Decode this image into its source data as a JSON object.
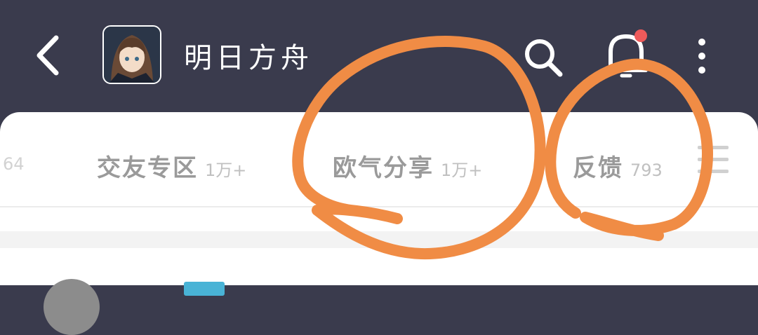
{
  "header": {
    "title": "明日方舟",
    "icons": [
      "back-arrow-icon",
      "app-avatar",
      "search-icon",
      "bell-icon",
      "more-vertical-icon"
    ],
    "has_notification": true
  },
  "tabs": {
    "leading_partial_count": "64",
    "items": [
      {
        "label": "交友专区",
        "count": "1万+"
      },
      {
        "label": "欧气分享",
        "count": "1万+"
      },
      {
        "label": "反馈",
        "count": "793"
      }
    ]
  },
  "colors": {
    "header_bg": "#3a3b4d",
    "card_bg": "#ffffff",
    "tab_text": "#9a9a9a",
    "notification_dot": "#ef5a5a",
    "annotation_orange": "#f08c45"
  }
}
